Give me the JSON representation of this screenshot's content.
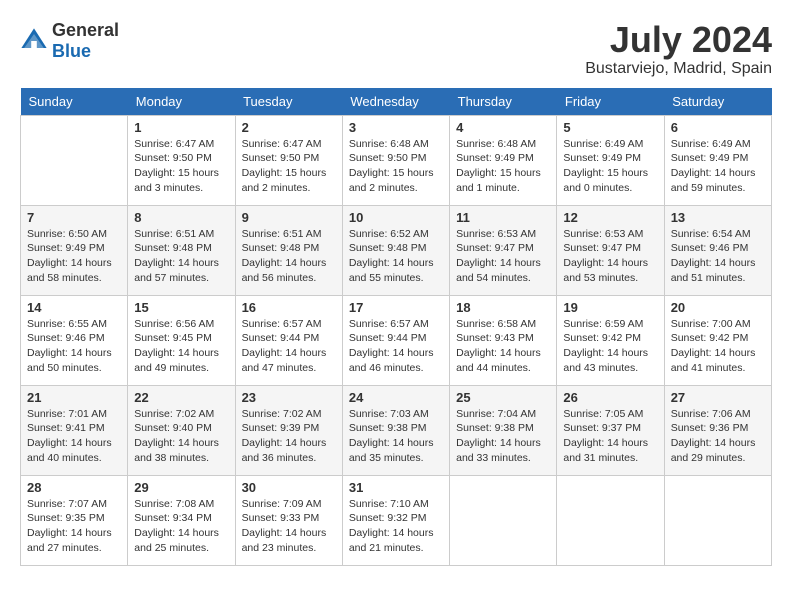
{
  "header": {
    "logo_general": "General",
    "logo_blue": "Blue",
    "month_year": "July 2024",
    "location": "Bustarviejo, Madrid, Spain"
  },
  "days_of_week": [
    "Sunday",
    "Monday",
    "Tuesday",
    "Wednesday",
    "Thursday",
    "Friday",
    "Saturday"
  ],
  "weeks": [
    [
      {
        "day": "",
        "info": ""
      },
      {
        "day": "1",
        "info": "Sunrise: 6:47 AM\nSunset: 9:50 PM\nDaylight: 15 hours\nand 3 minutes."
      },
      {
        "day": "2",
        "info": "Sunrise: 6:47 AM\nSunset: 9:50 PM\nDaylight: 15 hours\nand 2 minutes."
      },
      {
        "day": "3",
        "info": "Sunrise: 6:48 AM\nSunset: 9:50 PM\nDaylight: 15 hours\nand 2 minutes."
      },
      {
        "day": "4",
        "info": "Sunrise: 6:48 AM\nSunset: 9:49 PM\nDaylight: 15 hours\nand 1 minute."
      },
      {
        "day": "5",
        "info": "Sunrise: 6:49 AM\nSunset: 9:49 PM\nDaylight: 15 hours\nand 0 minutes."
      },
      {
        "day": "6",
        "info": "Sunrise: 6:49 AM\nSunset: 9:49 PM\nDaylight: 14 hours\nand 59 minutes."
      }
    ],
    [
      {
        "day": "7",
        "info": "Sunrise: 6:50 AM\nSunset: 9:49 PM\nDaylight: 14 hours\nand 58 minutes."
      },
      {
        "day": "8",
        "info": "Sunrise: 6:51 AM\nSunset: 9:48 PM\nDaylight: 14 hours\nand 57 minutes."
      },
      {
        "day": "9",
        "info": "Sunrise: 6:51 AM\nSunset: 9:48 PM\nDaylight: 14 hours\nand 56 minutes."
      },
      {
        "day": "10",
        "info": "Sunrise: 6:52 AM\nSunset: 9:48 PM\nDaylight: 14 hours\nand 55 minutes."
      },
      {
        "day": "11",
        "info": "Sunrise: 6:53 AM\nSunset: 9:47 PM\nDaylight: 14 hours\nand 54 minutes."
      },
      {
        "day": "12",
        "info": "Sunrise: 6:53 AM\nSunset: 9:47 PM\nDaylight: 14 hours\nand 53 minutes."
      },
      {
        "day": "13",
        "info": "Sunrise: 6:54 AM\nSunset: 9:46 PM\nDaylight: 14 hours\nand 51 minutes."
      }
    ],
    [
      {
        "day": "14",
        "info": "Sunrise: 6:55 AM\nSunset: 9:46 PM\nDaylight: 14 hours\nand 50 minutes."
      },
      {
        "day": "15",
        "info": "Sunrise: 6:56 AM\nSunset: 9:45 PM\nDaylight: 14 hours\nand 49 minutes."
      },
      {
        "day": "16",
        "info": "Sunrise: 6:57 AM\nSunset: 9:44 PM\nDaylight: 14 hours\nand 47 minutes."
      },
      {
        "day": "17",
        "info": "Sunrise: 6:57 AM\nSunset: 9:44 PM\nDaylight: 14 hours\nand 46 minutes."
      },
      {
        "day": "18",
        "info": "Sunrise: 6:58 AM\nSunset: 9:43 PM\nDaylight: 14 hours\nand 44 minutes."
      },
      {
        "day": "19",
        "info": "Sunrise: 6:59 AM\nSunset: 9:42 PM\nDaylight: 14 hours\nand 43 minutes."
      },
      {
        "day": "20",
        "info": "Sunrise: 7:00 AM\nSunset: 9:42 PM\nDaylight: 14 hours\nand 41 minutes."
      }
    ],
    [
      {
        "day": "21",
        "info": "Sunrise: 7:01 AM\nSunset: 9:41 PM\nDaylight: 14 hours\nand 40 minutes."
      },
      {
        "day": "22",
        "info": "Sunrise: 7:02 AM\nSunset: 9:40 PM\nDaylight: 14 hours\nand 38 minutes."
      },
      {
        "day": "23",
        "info": "Sunrise: 7:02 AM\nSunset: 9:39 PM\nDaylight: 14 hours\nand 36 minutes."
      },
      {
        "day": "24",
        "info": "Sunrise: 7:03 AM\nSunset: 9:38 PM\nDaylight: 14 hours\nand 35 minutes."
      },
      {
        "day": "25",
        "info": "Sunrise: 7:04 AM\nSunset: 9:38 PM\nDaylight: 14 hours\nand 33 minutes."
      },
      {
        "day": "26",
        "info": "Sunrise: 7:05 AM\nSunset: 9:37 PM\nDaylight: 14 hours\nand 31 minutes."
      },
      {
        "day": "27",
        "info": "Sunrise: 7:06 AM\nSunset: 9:36 PM\nDaylight: 14 hours\nand 29 minutes."
      }
    ],
    [
      {
        "day": "28",
        "info": "Sunrise: 7:07 AM\nSunset: 9:35 PM\nDaylight: 14 hours\nand 27 minutes."
      },
      {
        "day": "29",
        "info": "Sunrise: 7:08 AM\nSunset: 9:34 PM\nDaylight: 14 hours\nand 25 minutes."
      },
      {
        "day": "30",
        "info": "Sunrise: 7:09 AM\nSunset: 9:33 PM\nDaylight: 14 hours\nand 23 minutes."
      },
      {
        "day": "31",
        "info": "Sunrise: 7:10 AM\nSunset: 9:32 PM\nDaylight: 14 hours\nand 21 minutes."
      },
      {
        "day": "",
        "info": ""
      },
      {
        "day": "",
        "info": ""
      },
      {
        "day": "",
        "info": ""
      }
    ]
  ]
}
